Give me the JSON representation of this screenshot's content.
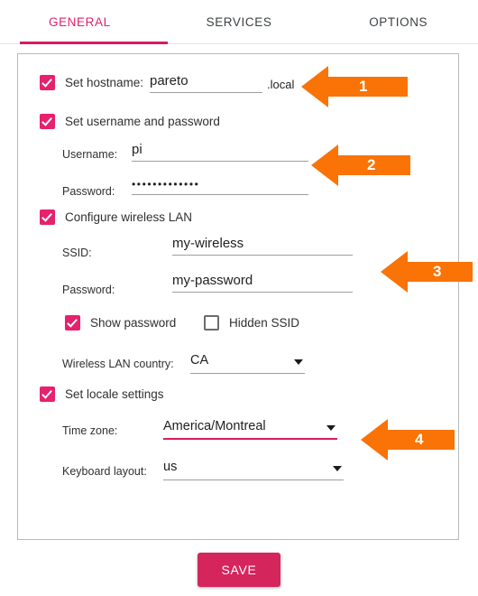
{
  "tabs": [
    {
      "label": "GENERAL",
      "active": true
    },
    {
      "label": "SERVICES",
      "active": false
    },
    {
      "label": "OPTIONS",
      "active": false
    }
  ],
  "form": {
    "hostname": {
      "checkbox_label": "Set hostname:",
      "checked": true,
      "value": "pareto",
      "suffix": ".local"
    },
    "user": {
      "checkbox_label": "Set username and password",
      "checked": true,
      "username_label": "Username:",
      "username_value": "pi",
      "password_label": "Password:",
      "password_value": "•••••••••••••"
    },
    "wireless": {
      "checkbox_label": "Configure wireless LAN",
      "checked": true,
      "ssid_label": "SSID:",
      "ssid_value": "my-wireless",
      "password_label": "Password:",
      "password_value": "my-password",
      "show_password_label": "Show password",
      "show_password_checked": true,
      "hidden_ssid_label": "Hidden SSID",
      "hidden_ssid_checked": false,
      "country_label": "Wireless LAN country:",
      "country_value": "CA"
    },
    "locale": {
      "checkbox_label": "Set locale settings",
      "checked": true,
      "timezone_label": "Time zone:",
      "timezone_value": "America/Montreal",
      "keyboard_label": "Keyboard layout:",
      "keyboard_value": "us"
    }
  },
  "actions": {
    "save_label": "SAVE"
  },
  "callouts": [
    {
      "number": "1"
    },
    {
      "number": "2"
    },
    {
      "number": "3"
    },
    {
      "number": "4"
    }
  ],
  "colors": {
    "accent": "#d81b60",
    "accent_checkbox": "#e6216e",
    "save_bg": "#d4255c",
    "callout_orange": "#f97306"
  }
}
